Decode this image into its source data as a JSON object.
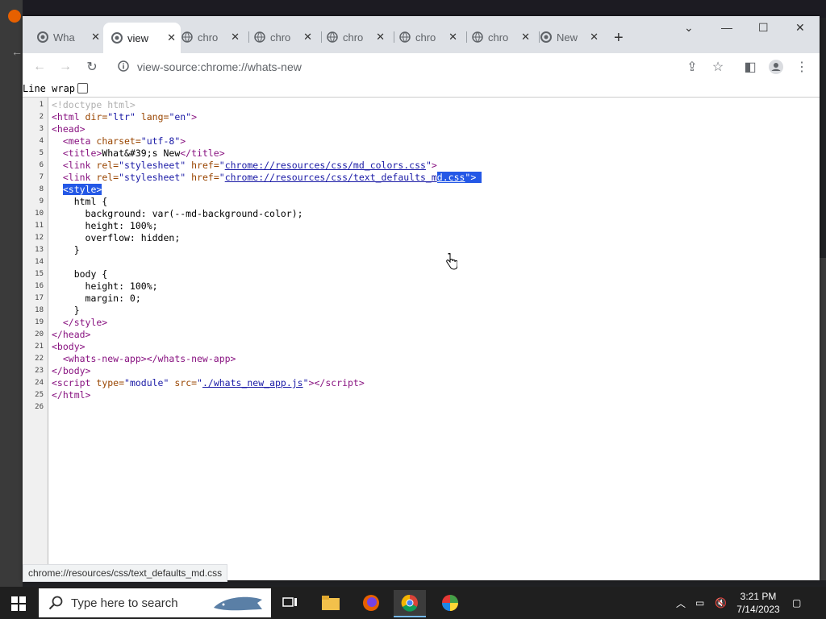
{
  "browser": {
    "tabs": [
      {
        "label": "Wha",
        "active": false
      },
      {
        "label": "view",
        "active": true
      },
      {
        "label": "chro",
        "active": false
      },
      {
        "label": "chro",
        "active": false
      },
      {
        "label": "chro",
        "active": false
      },
      {
        "label": "chro",
        "active": false
      },
      {
        "label": "chro",
        "active": false
      },
      {
        "label": "New",
        "active": false
      }
    ],
    "url": "view-source:chrome://whats-new",
    "line_wrap_label": "Line wrap",
    "status_url": "chrome://resources/css/text_defaults_md.css"
  },
  "source": {
    "lines": [
      {
        "n": "1",
        "html": "<span class=\"c-cmt\">&lt;!doctype html&gt;</span>"
      },
      {
        "n": "2",
        "html": "&lt;html <span class=\"c-attr\">dir=</span><span class=\"c-val\">\"ltr\"</span> <span class=\"c-attr\">lang=</span><span class=\"c-val\">\"en\"</span>&gt;"
      },
      {
        "n": "3",
        "html": "&lt;head&gt;"
      },
      {
        "n": "4",
        "html": "  &lt;meta <span class=\"c-attr\">charset=</span><span class=\"c-val\">\"utf-8\"</span>&gt;"
      },
      {
        "n": "5",
        "html": "  &lt;title&gt;<span class=\"c-text\">What&amp;#39;s New</span>&lt;/title&gt;"
      },
      {
        "n": "6",
        "html": "  &lt;link <span class=\"c-attr\">rel=</span><span class=\"c-val\">\"stylesheet\"</span> <span class=\"c-attr\">href=</span><span class=\"c-val\">\"</span><span class=\"c-link\">chrome://resources/css/md_colors.css</span><span class=\"c-val\">\"</span>&gt;"
      },
      {
        "n": "7",
        "html": "  &lt;link <span class=\"c-attr\">rel=</span><span class=\"c-val\">\"stylesheet\"</span> <span class=\"c-attr\">href=</span><span class=\"c-val\">\"</span><span class=\"c-link\">chrome://resources/css/text_defaults_m</span><span class=\"sel\"><span class=\"c-link\">d.css</span>\"&gt; </span>"
      },
      {
        "n": "8",
        "html": "  <span class=\"sel\">&lt;style&gt;</span>"
      },
      {
        "n": "9",
        "html": "<span class=\"c-text\">    html {</span>"
      },
      {
        "n": "10",
        "html": "<span class=\"c-text\">      background: var(--md-background-color);</span>"
      },
      {
        "n": "11",
        "html": "<span class=\"c-text\">      height: 100%;</span>"
      },
      {
        "n": "12",
        "html": "<span class=\"c-text\">      overflow: hidden;</span>"
      },
      {
        "n": "13",
        "html": "<span class=\"c-text\">    }</span>"
      },
      {
        "n": "14",
        "html": ""
      },
      {
        "n": "15",
        "html": "<span class=\"c-text\">    body {</span>"
      },
      {
        "n": "16",
        "html": "<span class=\"c-text\">      height: 100%;</span>"
      },
      {
        "n": "17",
        "html": "<span class=\"c-text\">      margin: 0;</span>"
      },
      {
        "n": "18",
        "html": "<span class=\"c-text\">    }</span>"
      },
      {
        "n": "19",
        "html": "  &lt;/style&gt;"
      },
      {
        "n": "20",
        "html": "&lt;/head&gt;"
      },
      {
        "n": "21",
        "html": "&lt;body&gt;"
      },
      {
        "n": "22",
        "html": "  &lt;whats-new-app&gt;&lt;/whats-new-app&gt;"
      },
      {
        "n": "23",
        "html": "&lt;/body&gt;"
      },
      {
        "n": "24",
        "html": "&lt;script <span class=\"c-attr\">type=</span><span class=\"c-val\">\"module\"</span> <span class=\"c-attr\">src=</span><span class=\"c-val\">\"</span><span class=\"c-link\">./whats_new_app.js</span><span class=\"c-val\">\"</span>&gt;&lt;/script&gt;"
      },
      {
        "n": "25",
        "html": "&lt;/html&gt;"
      },
      {
        "n": "26",
        "html": ""
      }
    ]
  },
  "taskbar": {
    "search_placeholder": "Type here to search",
    "time": "3:21 PM",
    "date": "7/14/2023"
  },
  "colors": {
    "selection": "#2458e6",
    "tabstrip": "#dee1e6",
    "taskbar": "#1f1f1f"
  }
}
